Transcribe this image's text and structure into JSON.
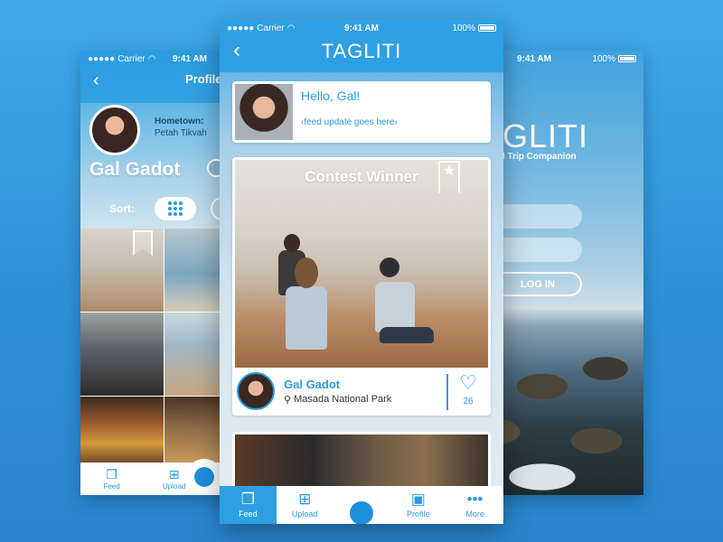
{
  "status": {
    "carrier": "Carrier",
    "time": "9:41 AM",
    "battery": "100%"
  },
  "left": {
    "title": "Profile",
    "hometown_label": "Hometown:",
    "hometown_value": "Petah Tikvah",
    "name": "Gal Gadot",
    "sort_label": "Sort:",
    "tabs": [
      {
        "label": "Feed",
        "icon": "feed-icon"
      },
      {
        "label": "Upload",
        "icon": "upload-icon"
      }
    ]
  },
  "right": {
    "title": "GLITI",
    "subtitle": "l Trip Companion",
    "login_label": "LOG IN"
  },
  "center": {
    "title": "TAGLITI",
    "greeting": "Hello, Gal!",
    "feed_update": "‹feed update goes here›",
    "contest_title": "Contest Winner",
    "post_author": "Gal Gadot",
    "post_location": "Masada National Park",
    "likes": "26",
    "tabs": [
      {
        "label": "Feed",
        "icon": "feed-icon"
      },
      {
        "label": "Upload",
        "icon": "upload-icon"
      },
      {
        "label": "",
        "icon": "record-icon"
      },
      {
        "label": "Profile",
        "icon": "profile-icon"
      },
      {
        "label": "More",
        "icon": "more-icon"
      }
    ]
  },
  "colors": {
    "brand": "#2e9fe2",
    "accent": "#1e8fdc",
    "background": "#3fa9ea"
  }
}
